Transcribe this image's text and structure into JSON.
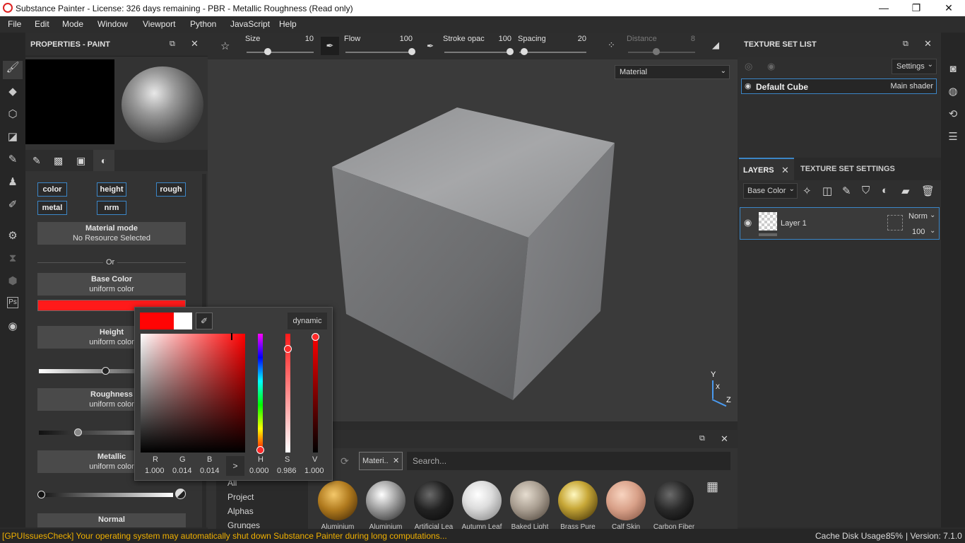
{
  "window": {
    "title": "Substance Painter - License: 326 days remaining - PBR - Metallic Roughness (Read only)",
    "minimize": "—",
    "restore": "❐",
    "close": "✕"
  },
  "menu": [
    "File",
    "Edit",
    "Mode",
    "Window",
    "Viewport",
    "Python",
    "JavaScript",
    "Help"
  ],
  "properties": {
    "title": "PROPERTIES - PAINT",
    "channels": [
      "color",
      "height",
      "rough",
      "metal",
      "nrm"
    ],
    "material_mode": {
      "label": "Material mode",
      "value": "No Resource Selected"
    },
    "or": "Or",
    "base_color": {
      "label": "Base Color",
      "value": "uniform color",
      "swatch": "#ff1a1a"
    },
    "height": {
      "label": "Height",
      "value": "uniform color"
    },
    "roughness": {
      "label": "Roughness",
      "value": "uniform color"
    },
    "metallic": {
      "label": "Metallic",
      "value": "uniform color"
    },
    "normal": {
      "label": "Normal"
    }
  },
  "toolbar": {
    "size": {
      "label": "Size",
      "value": "10"
    },
    "flow": {
      "label": "Flow",
      "value": "100"
    },
    "stroke_opacity": {
      "label": "Stroke opac",
      "value": "100"
    },
    "spacing": {
      "label": "Spacing",
      "value": "20"
    },
    "distance": {
      "label": "Distance",
      "value": "8"
    }
  },
  "viewport": {
    "display_mode": "Material",
    "axis_y": "Y",
    "axis_x": "X",
    "axis_z": "Z"
  },
  "color_picker": {
    "mode": "dynamic",
    "r": {
      "label": "R",
      "value": "1.000"
    },
    "g": {
      "label": "G",
      "value": "0.014"
    },
    "b": {
      "label": "B",
      "value": "0.014"
    },
    "h": {
      "label": "H",
      "value": "0.000"
    },
    "s": {
      "label": "S",
      "value": "0.986"
    },
    "v": {
      "label": "V",
      "value": "1.000"
    },
    "arrow": ">",
    "color": "#ff0404"
  },
  "texture_set_list": {
    "title": "TEXTURE SET LIST",
    "settings": "Settings",
    "item_name": "Default Cube",
    "item_shader": "Main shader"
  },
  "layers": {
    "tab_layers": "LAYERS",
    "tab_tss": "TEXTURE SET SETTINGS",
    "channel": "Base Color",
    "layer_name": "Layer 1",
    "blend": "Norm",
    "opacity": "100"
  },
  "shelf": {
    "filter_tag": "Materi..",
    "search_placeholder": "Search...",
    "categories": [
      "All",
      "Project",
      "Alphas",
      "Grunges"
    ],
    "materials": [
      "Aluminium",
      "Aluminium",
      "Artificial Lea",
      "Autumn Leaf",
      "Baked Light",
      "Brass Pure",
      "Calf Skin",
      "Carbon Fiber"
    ]
  },
  "status": {
    "warning": "[GPUIssuesCheck] Your operating system may automatically shut down Substance Painter during long computations...",
    "cache_label": "Cache Disk Usage:",
    "cache_value": "85%",
    "version": "| Version: 7.1.0"
  }
}
